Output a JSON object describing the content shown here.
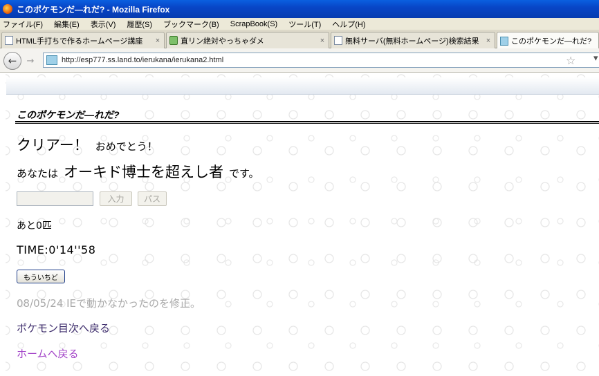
{
  "window": {
    "title": "このポケモンだ―れだ? - Mozilla Firefox",
    "icon": "firefox-icon"
  },
  "menu": [
    "ファイル(F)",
    "編集(E)",
    "表示(V)",
    "履歴(S)",
    "ブックマーク(B)",
    "ScrapBook(S)",
    "ツール(T)",
    "ヘルプ(H)"
  ],
  "tabs": [
    {
      "label": "HTML手打ちで作るホームページ講座",
      "icon": "page-icon",
      "active": false
    },
    {
      "label": "直リン絶対やっちゃダメ",
      "icon": "game-icon",
      "active": false
    },
    {
      "label": "無料サーバ(無料ホームページ)検索結果",
      "icon": "page-icon",
      "active": false
    },
    {
      "label": "このポケモンだ―れだ?",
      "icon": "pokemon-site-icon",
      "active": true
    }
  ],
  "nav": {
    "url": "http://esp777.ss.land.to/ierukana/ierukana2.html"
  },
  "page": {
    "title": "このポケモンだ―れだ?",
    "clear_main": "クリアー！",
    "clear_sub": "おめでとう！",
    "rank_pre": "あなたは",
    "rank_title": "オーキド博士を超えし者",
    "rank_post": "です。",
    "answer_value": "",
    "input_button": "入力",
    "pass_button": "パス",
    "remaining": "あと0匹",
    "time": "TIME:0'14''58",
    "retry_button": "もういちど",
    "note": "08/05/24 IEで動かなかったのを修正。",
    "link_index": "ポケモン目次へ戻る",
    "link_home": "ホームへ戻る"
  },
  "colors": {
    "titlebar": "#0846c7",
    "visited_link": "#a345c8",
    "link": "#3b2a6a",
    "note": "#a9a9a9"
  }
}
